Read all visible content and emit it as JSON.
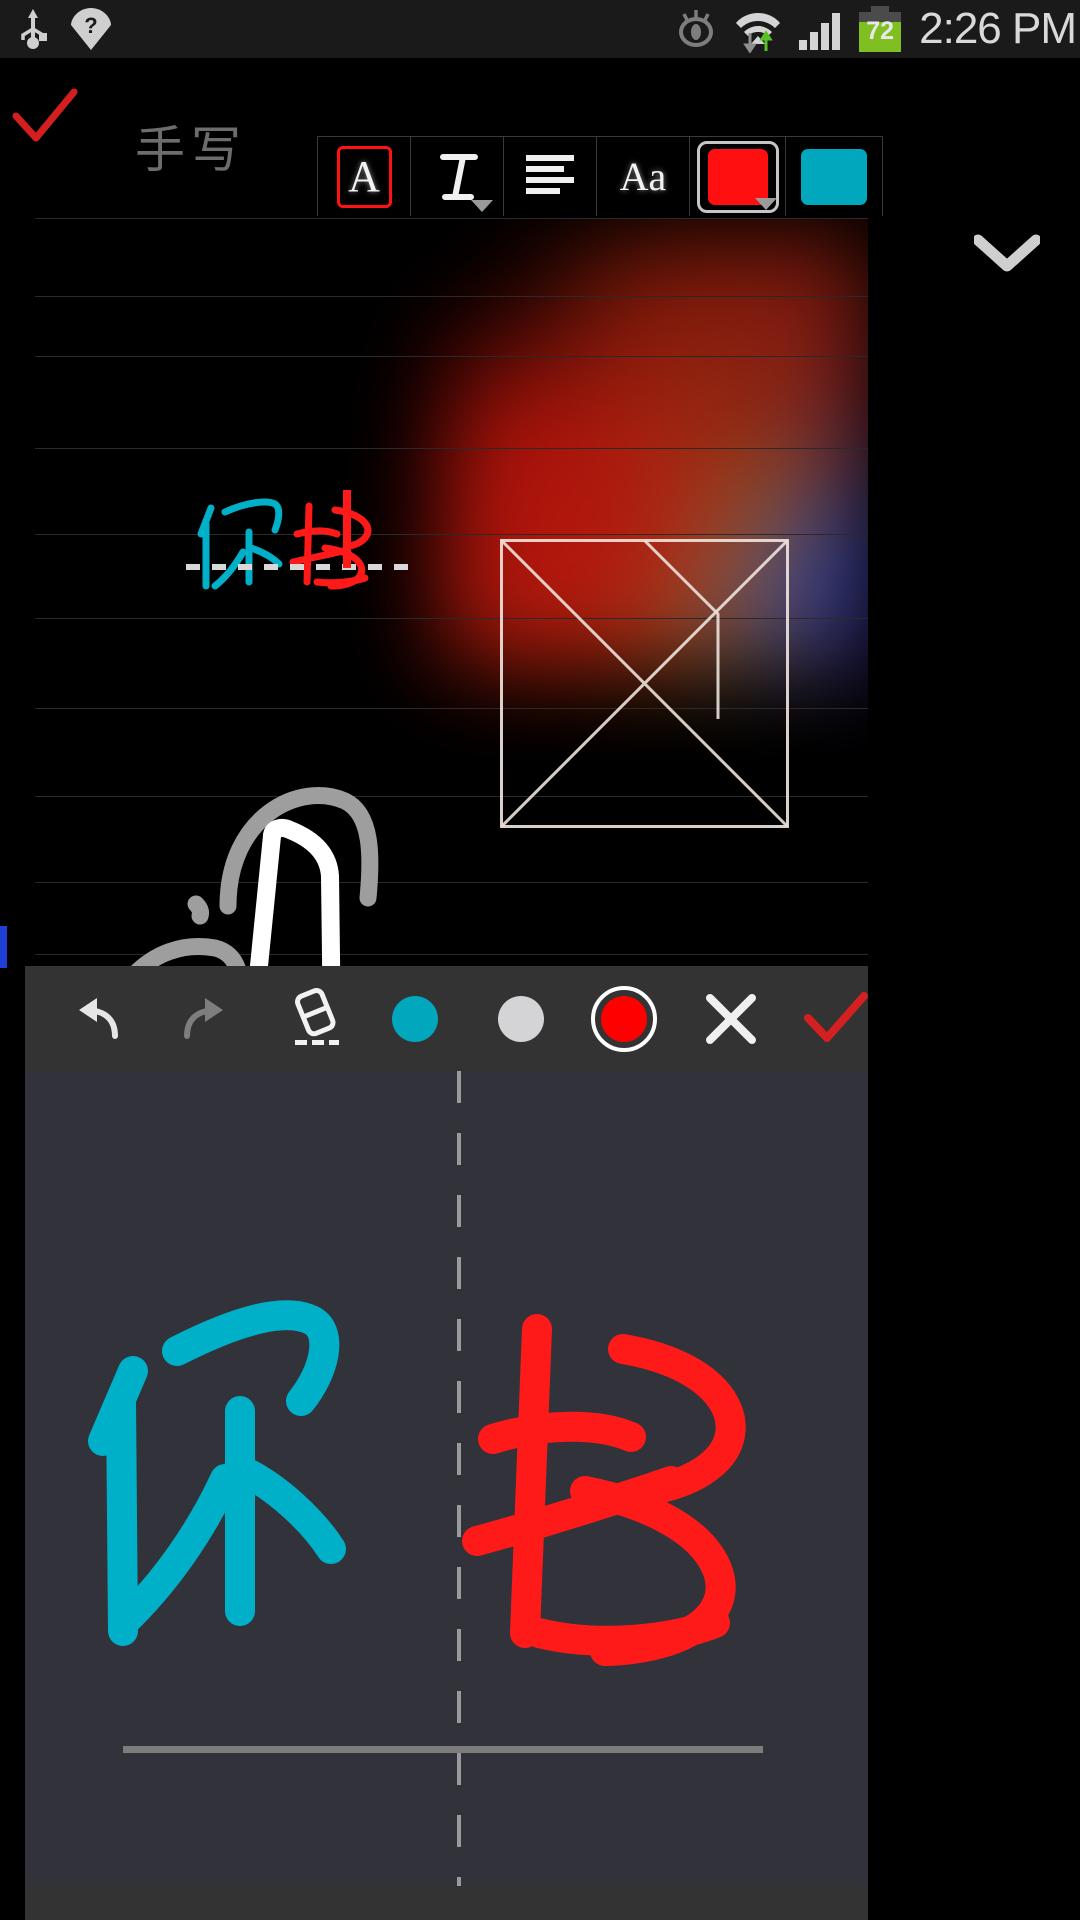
{
  "status_bar": {
    "icons": [
      "usb-icon",
      "wifi-unknown-icon",
      "eye-icon",
      "wifi-data-icon",
      "signal-bars-icon"
    ],
    "battery_percent": "72",
    "time": "2:26 PM"
  },
  "toolbar": {
    "confirm_icon": "check-icon",
    "title": "手写",
    "collapse_icon": "chevron-down-icon",
    "buttons": [
      {
        "name": "font-style-button",
        "glyph": "A",
        "selected": true,
        "has_caret": false
      },
      {
        "name": "text-format-button",
        "glyph": "T",
        "selected": false,
        "has_caret": true
      },
      {
        "name": "align-button",
        "glyph": "≣",
        "selected": false,
        "has_caret": false
      },
      {
        "name": "font-size-button",
        "glyph": "Aa",
        "selected": false,
        "has_caret": false
      }
    ],
    "color_primary": {
      "name": "text-color-swatch",
      "color": "#ff0f0f",
      "selected": true
    },
    "color_secondary": {
      "name": "highlight-color-swatch",
      "color": "#00a7bd",
      "selected": false
    }
  },
  "note": {
    "rule_line_color": "#2a2a2a",
    "handwriting_preview": {
      "characters": [
        {
          "char": "你",
          "color": "#00b0c8"
        },
        {
          "char": "好",
          "color": "#ff1a1a"
        }
      ],
      "caret_color": "#ff1a1a"
    },
    "image_placeholder": {
      "name": "image-placeholder",
      "border_color": "#e6ddd6",
      "width": "289",
      "height": "289"
    },
    "left_marker_color": "#1f3fd6",
    "scrollbar_color": "#8c8c8c"
  },
  "handwriting_panel": {
    "background": "#32323a",
    "toolbar": [
      {
        "name": "undo-button",
        "icon": "undo-icon",
        "enabled": true
      },
      {
        "name": "redo-button",
        "icon": "redo-icon",
        "enabled": false
      },
      {
        "name": "eraser-button",
        "icon": "eraser-icon",
        "enabled": true
      },
      {
        "name": "color-cyan-button",
        "icon": "color-dot-icon",
        "color": "#00a7bd",
        "selected": false
      },
      {
        "name": "color-white-button",
        "icon": "color-dot-icon",
        "color": "#d4d4d6",
        "selected": false
      },
      {
        "name": "color-red-button",
        "icon": "color-dot-icon",
        "color": "#ff0000",
        "selected": true
      },
      {
        "name": "cancel-button",
        "icon": "close-icon"
      },
      {
        "name": "confirm-button",
        "icon": "check-icon",
        "color": "#d42020"
      }
    ],
    "strokes": [
      {
        "char": "你",
        "color": "#00b0c8",
        "cell": "left"
      },
      {
        "char": "好",
        "color": "#ff1a1a",
        "cell": "right"
      }
    ],
    "divider_color": "#9a9a9a",
    "baseline_color": "#7c7c7c"
  }
}
